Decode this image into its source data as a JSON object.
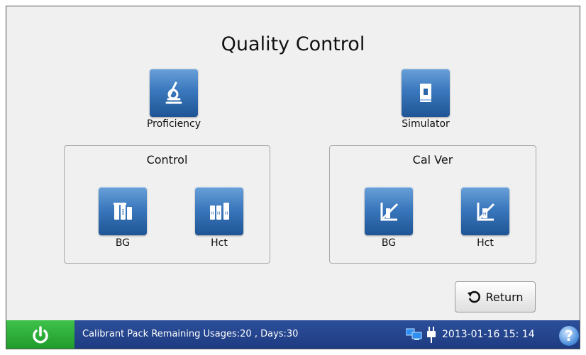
{
  "title": "Quality Control",
  "tiles": {
    "proficiency": "Proficiency",
    "simulator": "Simulator"
  },
  "control_group": {
    "title": "Control",
    "bg": "BG",
    "hct": "Hct"
  },
  "calver_group": {
    "title": "Cal Ver",
    "bg": "BG",
    "hct": "Hct"
  },
  "return_label": "Return",
  "status_bar": {
    "message": "Calibrant Pack Remaining Usages:20 , Days:30",
    "datetime": "2013-01-16  15: 14"
  },
  "icons": {
    "proficiency": "microscope-icon",
    "simulator": "cartridge-icon",
    "control_bg": "vials-icon",
    "control_hct": "hct-vials-icon",
    "calver_bg": "calibration-curve-icon",
    "calver_hct": "hct-calibration-curve-icon",
    "return": "return-arrow-icon",
    "power": "power-icon",
    "network": "network-icon",
    "plug": "plug-icon",
    "help": "help-icon"
  },
  "colors": {
    "tile": "#3a78bd",
    "status_bar": "#1d3a80",
    "power": "#2aa935"
  }
}
